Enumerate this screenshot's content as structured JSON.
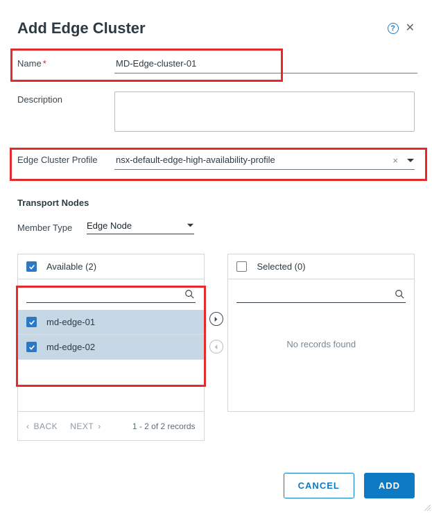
{
  "dialog": {
    "title": "Add Edge Cluster"
  },
  "form": {
    "name": {
      "label": "Name",
      "value": "MD-Edge-cluster-01"
    },
    "description": {
      "label": "Description",
      "value": ""
    },
    "profile": {
      "label": "Edge Cluster Profile",
      "value": "nsx-default-edge-high-availability-profile"
    }
  },
  "transport": {
    "section": "Transport Nodes",
    "member_type_label": "Member Type",
    "member_type_value": "Edge Node"
  },
  "available": {
    "header": "Available (2)",
    "items": [
      "md-edge-01",
      "md-edge-02"
    ],
    "back": "BACK",
    "next": "NEXT",
    "count": "1 - 2 of 2 records"
  },
  "selected": {
    "header": "Selected (0)",
    "empty": "No records found"
  },
  "footer": {
    "cancel": "CANCEL",
    "add": "ADD"
  }
}
